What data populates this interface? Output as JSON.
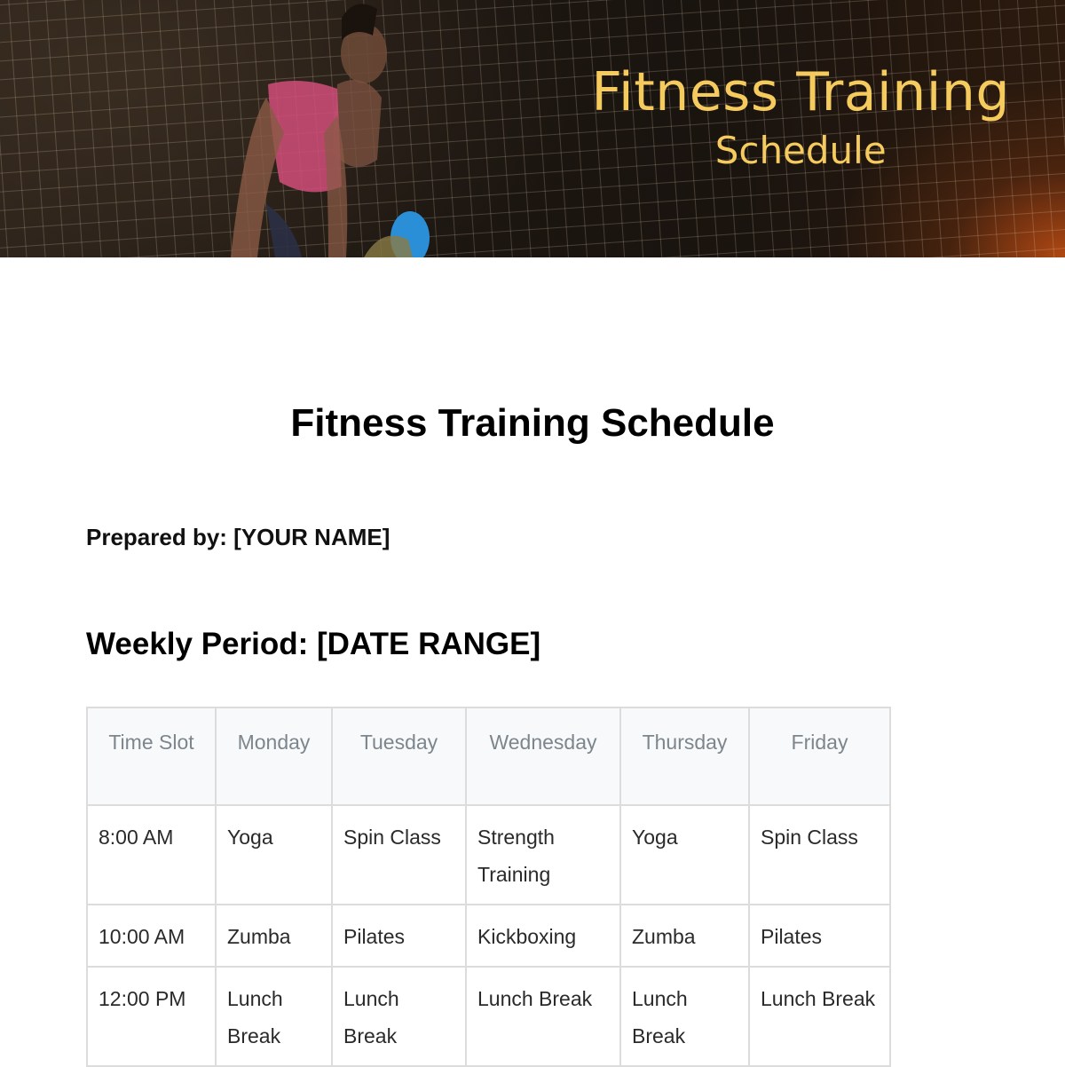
{
  "banner": {
    "title_line1": "Fitness Training",
    "title_line2": "Schedule",
    "title_color": "#f6cb5d",
    "image": "athlete-lifting-barbell-photo"
  },
  "document": {
    "title": "Fitness Training Schedule",
    "prepared_by": "Prepared by: [YOUR NAME]",
    "weekly_period": "Weekly Period: [DATE RANGE]"
  },
  "schedule": {
    "headers": [
      "Time Slot",
      "Monday",
      "Tuesday",
      "Wednesday",
      "Thursday",
      "Friday"
    ],
    "rows": [
      [
        "8:00 AM",
        "Yoga",
        "Spin Class",
        "Strength Training",
        "Yoga",
        "Spin Class"
      ],
      [
        "10:00 AM",
        "Zumba",
        "Pilates",
        "Kickboxing",
        "Zumba",
        "Pilates"
      ],
      [
        "12:00 PM",
        "Lunch Break",
        "Lunch Break",
        "Lunch Break",
        "Lunch Break",
        "Lunch Break"
      ]
    ]
  }
}
